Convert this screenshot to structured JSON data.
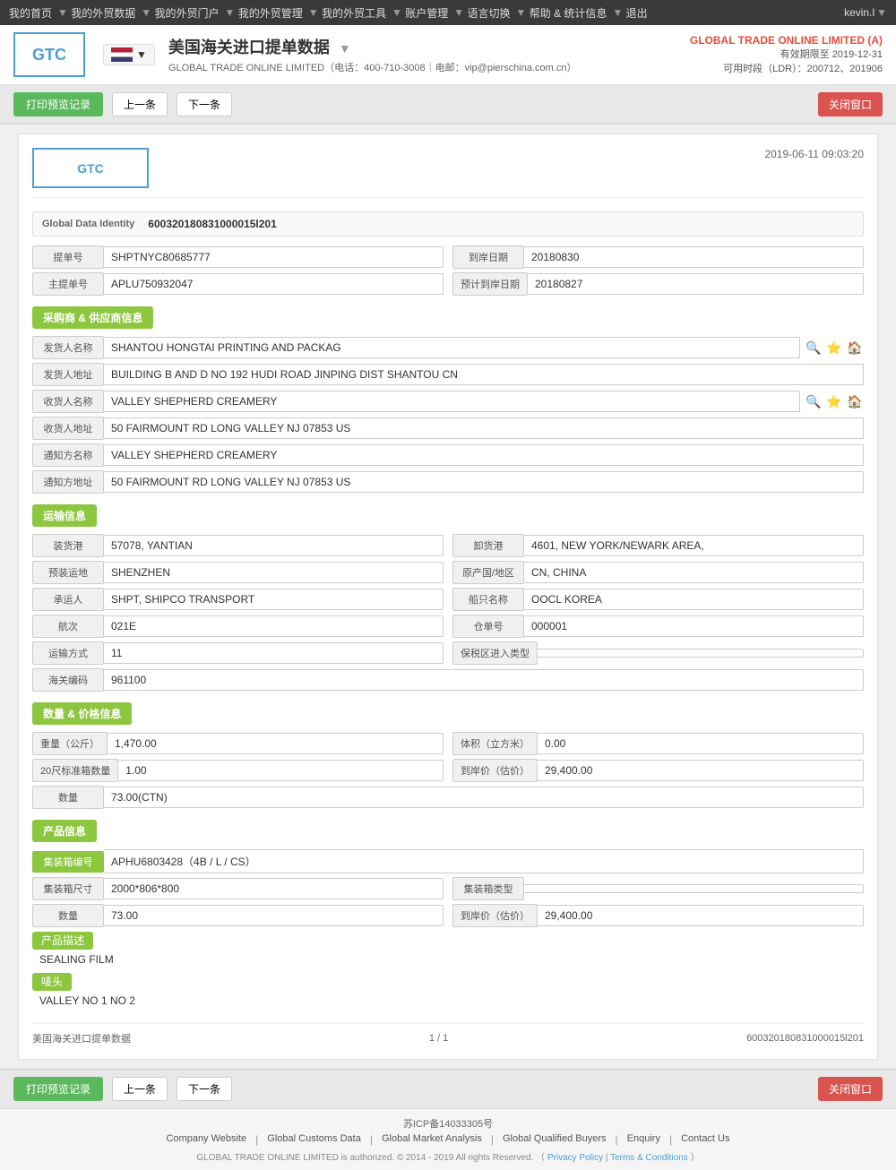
{
  "topnav": {
    "items": [
      {
        "label": "我的首页",
        "id": "home"
      },
      {
        "label": "我的外贸数据",
        "id": "data"
      },
      {
        "label": "我的外贸门户",
        "id": "portal"
      },
      {
        "label": "我的外贸管理",
        "id": "manage"
      },
      {
        "label": "我的外贸工具",
        "id": "tools"
      },
      {
        "label": "账户管理",
        "id": "account"
      },
      {
        "label": "语言切换",
        "id": "lang"
      },
      {
        "label": "帮助 & 统计信息",
        "id": "help"
      },
      {
        "label": "退出",
        "id": "exit"
      }
    ],
    "user": "kevin.l"
  },
  "header": {
    "logo_text": "GTC",
    "title": "美国海关进口提单数据",
    "subtitle": "GLOBAL TRADE ONLINE LIMITED（电话：400-710-3008｜电邮：vip@pierschina.com.cn）",
    "company": "GLOBAL TRADE ONLINE LIMITED (A)",
    "valid_until": "有效期限至 2019-12-31",
    "ldr": "可用时段（LDR）：200712、201906"
  },
  "actions": {
    "print": "打印预览记录",
    "prev": "上一条",
    "next": "下一条",
    "close": "关闭窗口"
  },
  "doc": {
    "logo_text": "GTC",
    "timestamp": "2019-06-11 09:03:20",
    "global_id_label": "Global Data Identity",
    "global_id_value": "600320180831000015l201",
    "bill_no_label": "提单号",
    "bill_no_value": "SHPTNYC80685777",
    "arrival_date_label": "到岸日期",
    "arrival_date_value": "20180830",
    "main_bill_label": "主提单号",
    "main_bill_value": "APLU750932047",
    "planned_date_label": "预计到岸日期",
    "planned_date_value": "20180827",
    "supplier_section": "采购商 & 供应商信息",
    "shipper_name_label": "发货人名称",
    "shipper_name_value": "SHANTOU HONGTAI PRINTING AND PACKAG",
    "shipper_addr_label": "发货人地址",
    "shipper_addr_value": "BUILDING B AND D NO 192 HUDI ROAD JINPING DIST SHANTOU CN",
    "consignee_name_label": "收货人名称",
    "consignee_name_value": "VALLEY SHEPHERD CREAMERY",
    "consignee_addr_label": "收货人地址",
    "consignee_addr_value": "50 FAIRMOUNT RD LONG VALLEY NJ 07853 US",
    "notify_name_label": "通知方名称",
    "notify_name_value": "VALLEY SHEPHERD CREAMERY",
    "notify_addr_label": "通知方地址",
    "notify_addr_value": "50 FAIRMOUNT RD LONG VALLEY NJ 07853 US",
    "transport_section": "运输信息",
    "load_port_label": "装货港",
    "load_port_value": "57078, YANTIAN",
    "unload_port_label": "卸货港",
    "unload_port_value": "4601, NEW YORK/NEWARK AREA,",
    "pre_transport_label": "预装运地",
    "pre_transport_value": "SHENZHEN",
    "origin_label": "原产国/地区",
    "origin_value": "CN, CHINA",
    "carrier_label": "承运人",
    "carrier_value": "SHPT, SHIPCO TRANSPORT",
    "vessel_label": "船只名称",
    "vessel_value": "OOCL KOREA",
    "voyage_label": "航次",
    "voyage_value": "021E",
    "warehouse_label": "仓单号",
    "warehouse_value": "000001",
    "transport_mode_label": "运输方式",
    "transport_mode_value": "11",
    "bonded_label": "保税区进入类型",
    "bonded_value": "",
    "customs_label": "海关编码",
    "customs_value": "961100",
    "quantity_section": "数量 & 价格信息",
    "weight_label": "重量（公斤）",
    "weight_value": "1,470.00",
    "volume_label": "体积（立方米）",
    "volume_value": "0.00",
    "container20_label": "20尺标准箱数量",
    "container20_value": "1.00",
    "arrival_price_label": "到岸价（估价）",
    "arrival_price_value": "29,400.00",
    "quantity_label": "数量",
    "quantity_value": "73.00(CTN)",
    "product_section": "产品信息",
    "container_no_label": "集装箱编号",
    "container_no_value": "APHU6803428（4B / L / CS）",
    "container_size_label": "集装箱尺寸",
    "container_size_value": "2000*806*800",
    "container_type_label": "集装箱类型",
    "container_type_value": "",
    "product_qty_label": "数量",
    "product_qty_value": "73.00",
    "product_price_label": "到岸价（估价）",
    "product_price_value": "29,400.00",
    "product_desc_label": "产品描述",
    "product_desc_value": "SEALING FILM",
    "mark_label": "唛头",
    "mark_value": "VALLEY NO 1 NO 2",
    "footer_title": "美国海关进口提单数据",
    "footer_page": "1 / 1",
    "footer_id": "600320180831000015l201"
  },
  "footer": {
    "icp": "苏ICP备14033305号",
    "links": [
      {
        "label": "Company Website"
      },
      {
        "label": "Global Customs Data"
      },
      {
        "label": "Global Market Analysis"
      },
      {
        "label": "Global Qualified Buyers"
      },
      {
        "label": "Enquiry"
      },
      {
        "label": "Contact Us"
      }
    ],
    "copyright": "GLOBAL TRADE ONLINE LIMITED is authorized. © 2014 - 2019 All rights Reserved.  （",
    "privacy": "Privacy Policy",
    "terms": "Terms & Conditions",
    "end": "）"
  }
}
